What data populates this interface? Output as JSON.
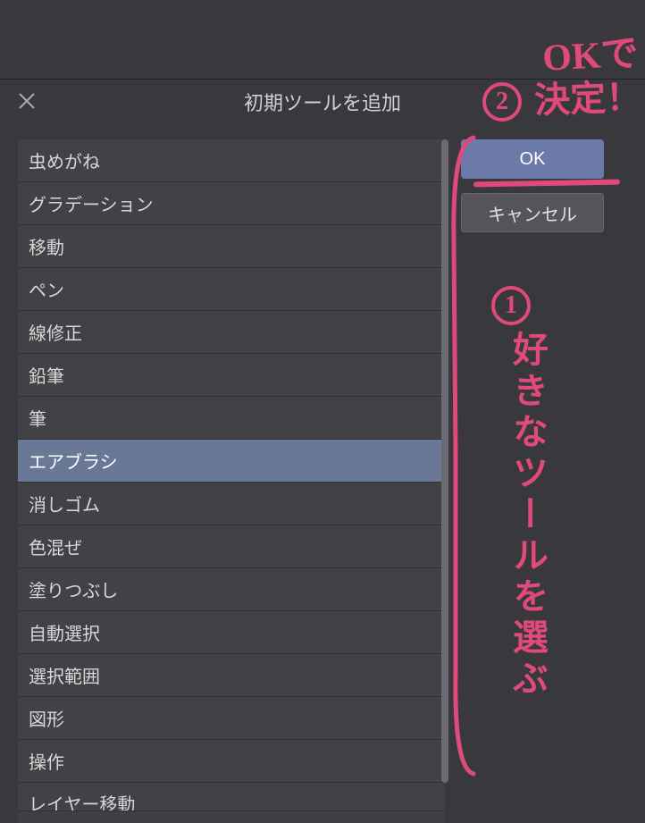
{
  "dialog": {
    "title": "初期ツールを追加",
    "items": [
      {
        "label": "虫めがね",
        "selected": false
      },
      {
        "label": "グラデーション",
        "selected": false
      },
      {
        "label": "移動",
        "selected": false
      },
      {
        "label": "ペン",
        "selected": false
      },
      {
        "label": "線修正",
        "selected": false
      },
      {
        "label": "鉛筆",
        "selected": false
      },
      {
        "label": "筆",
        "selected": false
      },
      {
        "label": "エアブラシ",
        "selected": true
      },
      {
        "label": "消しゴム",
        "selected": false
      },
      {
        "label": "色混ぜ",
        "selected": false
      },
      {
        "label": "塗りつぶし",
        "selected": false
      },
      {
        "label": "自動選択",
        "selected": false
      },
      {
        "label": "選択範囲",
        "selected": false
      },
      {
        "label": "図形",
        "selected": false
      },
      {
        "label": "操作",
        "selected": false
      },
      {
        "label": "レイヤー移動",
        "selected": false,
        "partial": true
      }
    ],
    "ok": "OK",
    "cancel": "キャンセル"
  },
  "annotations": {
    "top": "OKで",
    "circle2": "2",
    "kettei": "決定！",
    "circle1": "1",
    "vert": "好きなツールを選ぶ"
  }
}
